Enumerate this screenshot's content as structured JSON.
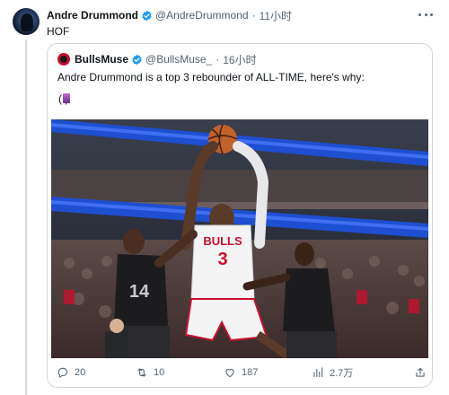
{
  "tweet": {
    "author_name": "Andre Drummond",
    "author_handle": "@AndreDrummond",
    "separator": "·",
    "time": "11小时",
    "text": "HOF"
  },
  "quoted": {
    "author_name": "BullsMuse",
    "author_handle": "@BullsMuse_",
    "separator": "·",
    "time": "16小时",
    "text": "Andre Drummond is a top 3 rebounder of ALL-TIME, here's why:",
    "emoji_line": "( )"
  },
  "photo": {
    "jersey_team": "BULLS",
    "jersey_number": "3",
    "defender_number": "14"
  },
  "actions": {
    "replies": "20",
    "retweets": "10",
    "likes": "187",
    "views": "2.7万"
  },
  "colors": {
    "verified": "#1d9bf0",
    "text_secondary": "#536471",
    "border": "#cfd9de",
    "bulls_red": "#c8102e"
  },
  "icons": [
    "verified-badge-icon",
    "more-icon",
    "reply-icon",
    "retweet-icon",
    "like-icon",
    "views-icon",
    "share-icon"
  ]
}
